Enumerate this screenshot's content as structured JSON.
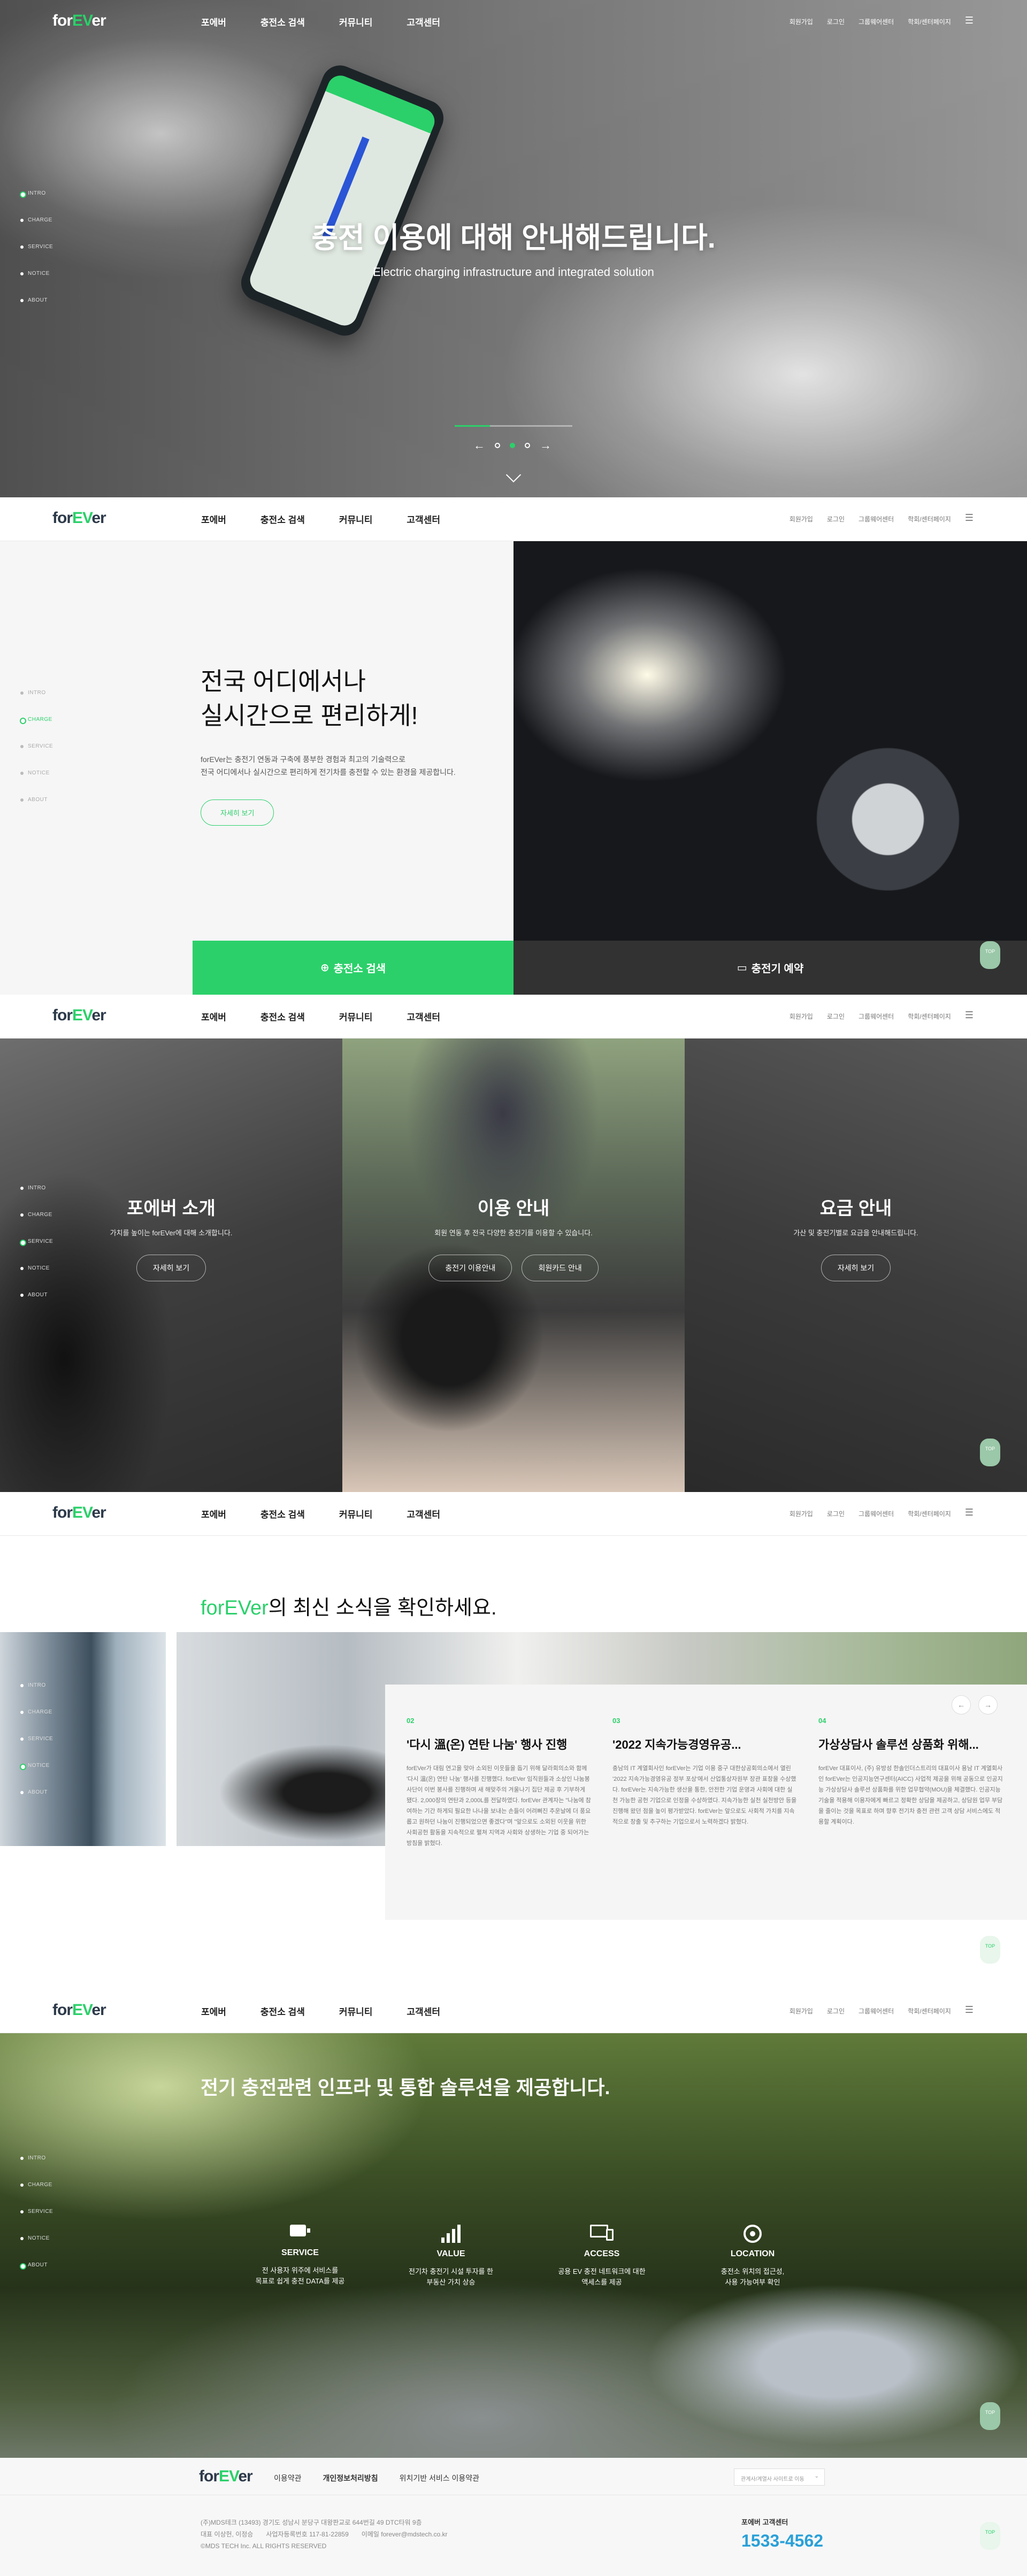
{
  "nav": {
    "logo_a": "for",
    "logo_b": "EV",
    "logo_c": "er",
    "menu": [
      "포에버",
      "충전소 검색",
      "커뮤니티",
      "고객센터"
    ],
    "util": [
      "회원가입",
      "로그인",
      "그룹웨어센터",
      "학회/센터페이지"
    ]
  },
  "side_labels": [
    "INTRO",
    "CHARGE",
    "SERVICE",
    "NOTICE",
    "ABOUT"
  ],
  "top_label": "TOP",
  "hero": {
    "title": "충전 이용에 대해 안내해드립니다.",
    "subtitle": "Electric charging infrastructure and integrated solution",
    "prev": "←",
    "next": "→",
    "progress": 0.3
  },
  "charge": {
    "title_1": "전국 어디에서나",
    "title_2": "실시간으로 편리하게!",
    "desc_1": "forEVer는 충전기 연동과 구축에 풍부한 경험과 최고의 기술력으로",
    "desc_2": "전국 어디에서나 실시간으로 편리하게 전기차를 충전할 수 있는 환경을 제공합니다.",
    "more": "자세히 보기",
    "btn_search": "충전소 검색",
    "btn_reserve": "충전기 예약"
  },
  "service": {
    "cards": [
      {
        "title": "포에버 소개",
        "desc": "가치를 높이는 forEVer에 대해 소개합니다.",
        "buttons": [
          "자세히 보기"
        ]
      },
      {
        "title": "이용 안내",
        "desc": "회원 연동 후 전국 다양한 충전기를 이용할 수 있습니다.",
        "buttons": [
          "충전기 이용안내",
          "회원카드 안내"
        ]
      },
      {
        "title": "요금 안내",
        "desc": "가산 및 충전기별로 요금을 안내해드립니다.",
        "buttons": [
          "자세히 보기"
        ]
      }
    ]
  },
  "notice": {
    "title_brand": "forEVer",
    "title_rest": "의 최신 소식을 확인하세요.",
    "prev": "←",
    "next": "→",
    "items": [
      {
        "num": "02",
        "title": "'다시 溫(온) 연탄 나눔' 행사 진행",
        "body": "forEVer가 대림 연고을 맞아 소외된 이웃들을 돕기 위해 달라회의소와 함께 '다시 溫(온) 연탄 나눔' 행사를 진행했다. forEVer 임직원들과 소상인 나눔봉사단이 이번 봉사를 진행하며 새 해맞주의 겨울나기 집단 제공 후 기부하게 됐다. 2,000장의 연탄과 2,000L를 전달하였다. forEVer 관계자는 \"나눔에 참여하는 기간 하게되 필요한 나나을 보내는 손들이 어려뻐진 추운날에 더 풍요롭고 원하던 나눔이 진행되었으면 좋겠다\"며 \"앞으로도 소외된 이웃을 위한 사회공헌 활동을 지속적으로 펼쳐 지역과 사회와 상생하는 기업 중 되어가는 방침을 밝혔다."
      },
      {
        "num": "03",
        "title": "'2022 지속가능경영유공...",
        "body": "충남의 IT 계열회사인 forEVer는 기업 이용 중구 대한상공회의소에서 열린 '2022 지속가능경영유공 정부 포상'에서 산업통상자원부 장관 표창을 수상했다. forEVer는 지속가능한 생산을 통한, 안전한 기업 운영과 사회에 대한 실천 가능한 공헌 기업으로 인정을 수상하였다. 지속가능한 실천 실천방안 등을 진행해 왔던 점을 높이 평가받았다. forEVer는 앞으로도 사회적 가치를 지속적으로 창출 및 추구하는 기업으로서 노력하겠다 밝혔다."
      },
      {
        "num": "04",
        "title": "가상상담사 솔루션 상품화 위해...",
        "body": "forEVer 대표이사, (주) 유방성 한솔인더스트리의 대표이사 용남 IT 계열회사인 forEVer는 인공지능연구센터(AICC) 사업적 제공을 위해 공동으로 인공지능 가상상담사 솔루션 상품화를 위한 업무협약(MOU)을 체결했다. 인공지능 기술을 적용해 이용자에게 빠르고 정확한 상담을 제공하고, 상담원 업무 부담을 줄이는 것을 목표로 하며 향후 전기차 충전 관련 고객 상담 서비스에도 적용할 계획이다."
      }
    ]
  },
  "about": {
    "title": "전기 충전관련 인프라 및 통합 솔루션을 제공합니다.",
    "items": [
      {
        "icon": "battery-icon",
        "label": "SERVICE",
        "desc_1": "전 사용자 위주에 서비스를",
        "desc_2": "목표로 쉽게 충전 DATA를 제공"
      },
      {
        "icon": "signal-icon",
        "label": "VALUE",
        "desc_1": "전기차 충전기 시설 투자를 한",
        "desc_2": "부동산 가치 상승"
      },
      {
        "icon": "device-icon",
        "label": "ACCESS",
        "desc_1": "공용 EV 충전 네트워크에 대한",
        "desc_2": "액세스를 제공"
      },
      {
        "icon": "location-icon",
        "label": "LOCATION",
        "desc_1": "충전소 위치의 접근성,",
        "desc_2": "사용 가능여부 확인"
      }
    ]
  },
  "footer": {
    "links": [
      "이용약관",
      "개인정보처리방침",
      "위치기반 서비스 이용약관"
    ],
    "family_site": "관계사/계열사 사이트로 이동",
    "addr_1": "(주)MDS테크 (13493) 경기도 성남시 분당구 대왕판교로 644번길 49 DTC타워 9층",
    "addr_2a": "대표 이상헌, 이정승",
    "addr_2b": "사업자등록번호 117-81-22859",
    "addr_2c": "이메일 forever@mdstech.co.kr",
    "copyright": "©MDS TECH Inc. ALL RIGHTS RESERVED",
    "cs_label": "포에버 고객센터",
    "cs_phone": "1533-4562"
  },
  "colors": {
    "accent": "#2bd06a",
    "dark": "#323232"
  }
}
